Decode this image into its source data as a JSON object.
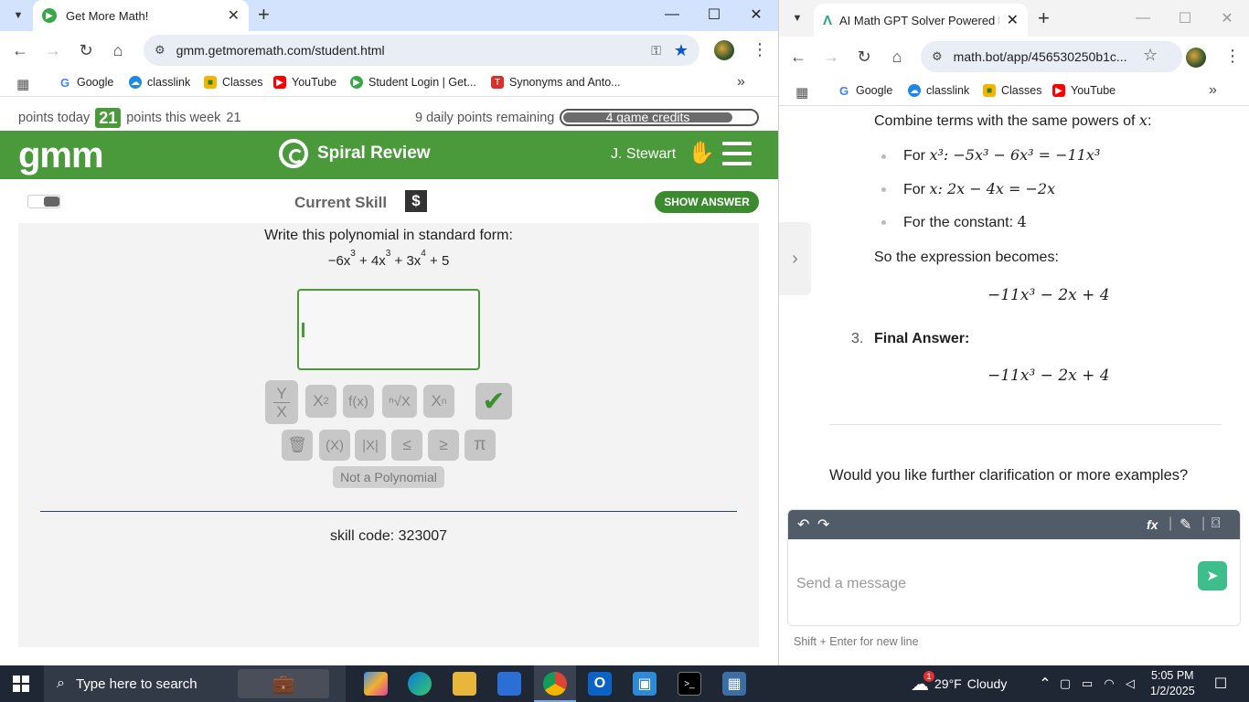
{
  "left": {
    "tab_title": "Get More Math!",
    "url": "gmm.getmoremath.com/student.html",
    "bookmarks": [
      "Google",
      "classlink",
      "Classes",
      "YouTube",
      "Student Login | Get...",
      "Synonyms and Anto..."
    ],
    "points_today_label": "points today",
    "points_today": "21",
    "points_week_label": "points this week",
    "points_week": "21",
    "daily_remaining": "9 daily points remaining",
    "credits": "4 game credits",
    "credits_fill": 0.88,
    "logo": "gmm",
    "section": "Spiral Review",
    "user": "J. Stewart",
    "current_skill": "Current Skill",
    "dollar": "$",
    "show_answer": "SHOW ANSWER",
    "prompt": "Write this polynomial in standard form:",
    "poly": {
      "t1": "−6x",
      "e1": "3",
      "t2": " + 4x",
      "e2": "3",
      "t3": " + 3x",
      "e3": "4",
      "t4": " + 5"
    },
    "keys": {
      "frac_top": "Y",
      "frac_bot": "X",
      "power": "X",
      "power_exp": "2",
      "fx": "f(x)",
      "root": "ⁿ√X",
      "sub": "X",
      "sub_n": "n",
      "trash": "🗑",
      "paren": "(X)",
      "abs": "|X|",
      "le": "≤",
      "ge": "≥",
      "pi": "π",
      "check": "✔"
    },
    "not_poly": "Not a Polynomial",
    "skill_code": "skill code: 323007"
  },
  "right": {
    "tab_title": "AI Math GPT Solver Powered by",
    "url": "math.bot/app/456530250b1c...",
    "bookmarks": [
      "Google",
      "classlink",
      "Classes",
      "YouTube"
    ],
    "combine_intro": "Combine terms with the same powers of",
    "var_x": "x",
    "colon": ":",
    "b1_prefix": "For",
    "b1_math": "x³: −5x³ − 6x³ = −11x³",
    "b2_prefix": "For",
    "b2_math": "x: 2x − 4x = −2x",
    "b3_text": "For the constant:",
    "b3_math": "4",
    "becomes": "So the expression becomes:",
    "expr1": "−11x³ − 2x + 4",
    "step_num": "3.",
    "final_label": "Final Answer:",
    "expr2": "−11x³ − 2x + 4",
    "followup": "Would you like further clarification or more examples?",
    "fx_label": "fx",
    "placeholder": "Send a message",
    "hint": "Shift + Enter for new line"
  },
  "taskbar": {
    "search_placeholder": "Type here to search",
    "weather_temp": "29°F",
    "weather_text": "Cloudy",
    "weather_badge": "1",
    "time": "5:05 PM",
    "date": "1/2/2025"
  },
  "colors": {
    "gmm_green": "#4a9a3b",
    "chrome_tabbar": "#d3e3fd",
    "mathbot_green": "#3dbe8b",
    "taskbar": "#1f2634"
  }
}
